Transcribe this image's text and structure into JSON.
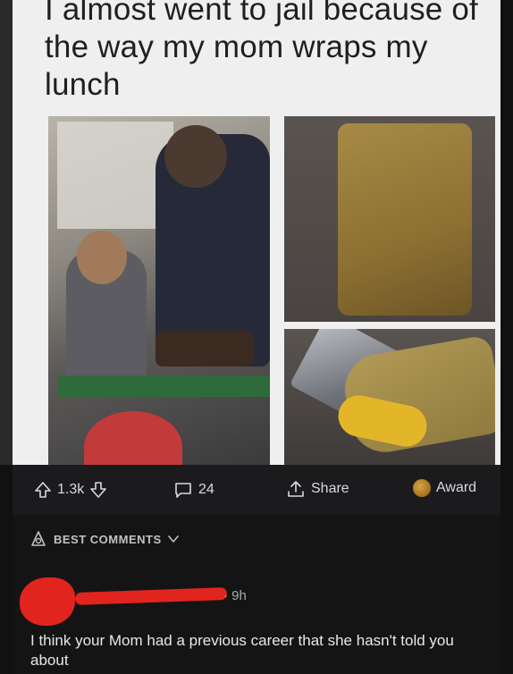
{
  "post": {
    "meme_title": "I almost went to jail because of the way my mom wraps my lunch"
  },
  "actions": {
    "votes": "1.3k",
    "comments": "24",
    "share": "Share",
    "award": "Award"
  },
  "sort": {
    "label": "BEST COMMENTS"
  },
  "comment": {
    "time": "· 9h",
    "body": "I think your Mom had a previous career that she hasn't told you about"
  },
  "colors": {
    "background": "#1a1a1b",
    "text": "#d7dadc",
    "redaction": "#e2241f"
  },
  "icons": [
    "upvote-icon",
    "downvote-icon",
    "comment-icon",
    "share-icon",
    "award-icon",
    "sort-icon",
    "chevron-down-icon"
  ]
}
